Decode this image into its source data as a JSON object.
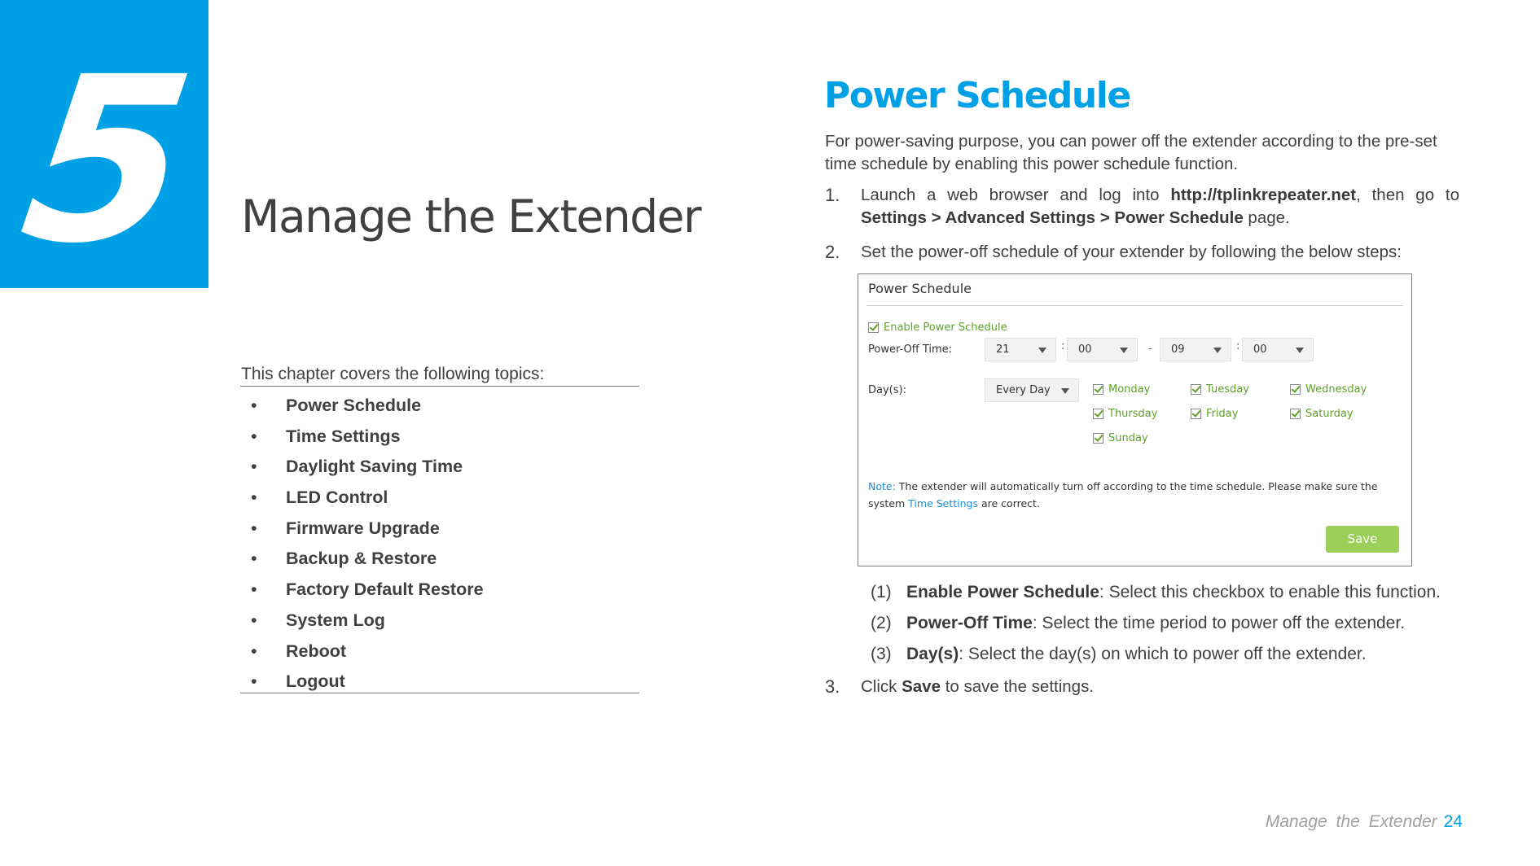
{
  "chapter": {
    "number": "5",
    "title": "Manage the Extender",
    "accent_color": "#00A0E6"
  },
  "topics": {
    "intro": "This chapter covers the following topics:",
    "bullet": "•",
    "items": [
      "Power Schedule",
      "Time Settings",
      "Daylight Saving Time",
      "LED Control",
      "Firmware Upgrade",
      "Backup & Restore",
      "Factory Default Restore",
      "System Log",
      "Reboot",
      "Logout"
    ]
  },
  "section": {
    "title": "Power Schedule",
    "intro": "For power-saving purpose, you can power off the extender according to the pre-set time schedule by enabling this power schedule function.",
    "steps": [
      {
        "num": "1.",
        "text_a": "Launch a web browser and log into ",
        "bold_a": "http://tplinkrepeater.net",
        "text_b": ", then go to ",
        "bold_b": "Settings > Advanced Settings > Power Schedule",
        "text_c": " page."
      },
      {
        "num": "2.",
        "text_a": "Set the power-off schedule of your extender by following the below steps:"
      },
      {
        "num": "3.",
        "text_a": "Click ",
        "bold_a": "Save",
        "text_b": " to save the settings."
      }
    ],
    "sub_steps": [
      {
        "idx": "(1)",
        "term": "Enable Power Schedule",
        "desc": ": Select this checkbox to enable this function."
      },
      {
        "idx": "(2)",
        "term": "Power-Off Time",
        "desc": ": Select the time period to power off the extender."
      },
      {
        "idx": "(3)",
        "term": "Day(s)",
        "desc": ": Select the day(s) on which to power off the extender."
      }
    ]
  },
  "panel": {
    "title": "Power Schedule",
    "enable_label": "Enable Power Schedule",
    "enable_checked": true,
    "power_off_label": "Power-Off Time:",
    "start_hour": "21",
    "start_minute": "00",
    "end_hour": "09",
    "end_minute": "00",
    "colon": ":",
    "dash": "-",
    "days_label": "Day(s):",
    "days_mode": "Every Day",
    "days": [
      {
        "name": "Monday",
        "checked": true
      },
      {
        "name": "Tuesday",
        "checked": true
      },
      {
        "name": "Wednesday",
        "checked": true
      },
      {
        "name": "Thursday",
        "checked": true
      },
      {
        "name": "Friday",
        "checked": true
      },
      {
        "name": "Saturday",
        "checked": true
      },
      {
        "name": "Sunday",
        "checked": true
      }
    ],
    "note_label": "Note:",
    "note_text_a": " The extender will automatically turn off according to the time schedule. Please make sure the system ",
    "note_link": "Time Settings",
    "note_text_b": " are correct.",
    "save_label": "Save",
    "save_color": "#9BCF57",
    "checkbox_color": "#5FA12A"
  },
  "footer": {
    "text": "Manage the Extender",
    "page": "24"
  }
}
